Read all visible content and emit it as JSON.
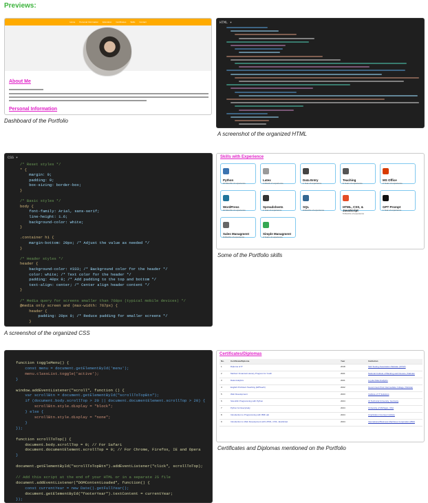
{
  "heading": "Previews:",
  "cards": {
    "dashboard": {
      "caption": "Dashboard of the Portfolio",
      "nav_items": [
        "Home",
        "Personal Information",
        "Education",
        "Certificates",
        "Skills",
        "Contact"
      ],
      "about_title": "About Me",
      "personal_title": "Personal Information"
    },
    "html_card": {
      "caption": "A screenshot of the organized HTML",
      "tab_label": "HTML ▾"
    },
    "css_card": {
      "caption": "A screenshot of the organized CSS",
      "tab_label": "CSS ▾",
      "lines": [
        "/* Reset styles */",
        "* {",
        "    margin: 0;",
        "    padding: 0;",
        "    box-sizing: border-box;",
        "}",
        "",
        "/* Basic styles */",
        "body {",
        "    font-family: Arial, sans-serif;",
        "    line-height: 1.6;",
        "    background-color: white;",
        "}",
        "",
        ".container h1 {",
        "    margin-bottom: 20px; /* Adjust the value as needed */",
        "}",
        "",
        "/* Header styles */",
        "header {",
        "    background-color: #333; /* Background color for the header */",
        "    color: white; /* Text color for the header */",
        "    padding: 40px 0; /* Add padding to the top and bottom */",
        "    text-align: center; /* Center align header content */",
        "}",
        "",
        "/* Media query for screens smaller than 768px (typical mobile devices) */",
        "@media only screen and (max-width: 767px) {",
        "    header {",
        "        padding: 20px 0; /* Reduce padding for smaller screens */",
        "    }"
      ]
    },
    "skills_card": {
      "caption": "Some of the Portfolio skills",
      "title": "Skills with Experience",
      "skills": [
        {
          "name": "Python",
          "sub": "10 Months of experience",
          "color": "#3b73b0"
        },
        {
          "name": "Latex",
          "sub": "1 Month of experience",
          "color": "#9a9a9a"
        },
        {
          "name": "Data Entry",
          "sub": "1 Year of experience",
          "color": "#444444"
        },
        {
          "name": "Teaching",
          "sub": "6 Years of experience",
          "color": "#555555"
        },
        {
          "name": "MS Office",
          "sub": "2 Years of experience",
          "color": "#d83b01"
        },
        {
          "name": "WordPress",
          "sub": "10 Months of experience",
          "color": "#21759b"
        },
        {
          "name": "Spreadsheets",
          "sub": "1 Year of experience",
          "color": "#333333"
        },
        {
          "name": "SQL",
          "sub": "9 Months of experience",
          "color": "#336791"
        },
        {
          "name": "HTML, CSS, & JavaScript",
          "sub": "5 Months of experience",
          "color": "#e44d26"
        },
        {
          "name": "GPT Prompt",
          "sub": "1 Year of experience",
          "color": "#111111"
        },
        {
          "name": "Sales Managment",
          "sub": "6 Months of experience",
          "color": "#666666"
        },
        {
          "name": "Simple Managment",
          "sub": "2 Years of experience",
          "color": "#34a853"
        }
      ]
    },
    "js_card": {
      "caption": "",
      "lines": [
        "function toggleMenu() {",
        "    const menu = document.getElementById('menu');",
        "    menu.classList.toggle('active');",
        "}",
        "",
        "window.addEventListener(\"scroll\", function () {",
        "    var scrollBtn = document.getElementById(\"scrollToTopBtn\");",
        "    if (document.body.scrollTop > 20 || document.documentElement.scrollTop > 20) {",
        "        scrollBtn.style.display = \"block\";",
        "    } else {",
        "        scrollBtn.style.display = \"none\";",
        "    }",
        "});",
        "",
        "function scrollToTop() {",
        "    document.body.scrollTop = 0; // For Safari",
        "    document.documentElement.scrollTop = 0; // For Chrome, Firefox, IE and Opera",
        "}",
        "",
        "document.getElementById(\"scrollToTopBtn\").addEventListener(\"click\", scrollToTop);",
        "",
        "// Add this script at the end of your HTML or in a separate JS file",
        "document.addEventListener(\"DOMContentLoaded\", function() {",
        "    const currentYear = new Date().getFullYear();",
        "    document.getElementById(\"footerYear\").textContent = currentYear;",
        "});"
      ]
    },
    "certs_card": {
      "caption": "Certificates and Diplomas mentioned on the Portfolio",
      "title": "Certificates/Diplomas",
      "headers": [
        "No.",
        "Certificate/Diploma",
        "Year",
        "Institution"
      ],
      "rows": [
        [
          "1",
          "Diploma of IT",
          "2018",
          "Skill Testing Association Pakistan (STAP)"
        ],
        [
          "2",
          "Method: Financial Literacy Program for Youth",
          "2021",
          "National Institute of Banking and Finance, Pakistan"
        ],
        [
          "3",
          "Data Analytics",
          "2021",
          "Loyola Data Analytics"
        ],
        [
          "4",
          "English Proficient Teaching (EPTeach)",
          "2022",
          "Government Post Intermediate College, Pakistan"
        ],
        [
          "5",
          "Web Development",
          "2023",
          "Institute of IT Solutions"
        ],
        [
          "6",
          "Scientific Programming with Python",
          "2024",
          "UI Technical University, Germany"
        ],
        [
          "7",
          "Python for Everybody",
          "2024",
          "University of Michigan, USA"
        ],
        [
          "8",
          "Introduction to Programming with IBM Lab",
          "2024",
          "Amplication Courses Institute"
        ],
        [
          "9",
          "Introduction to Web Development with HTML, CSS, JavaScript",
          "2024",
          "International Business Machines Corporation (IBM)"
        ]
      ]
    }
  }
}
